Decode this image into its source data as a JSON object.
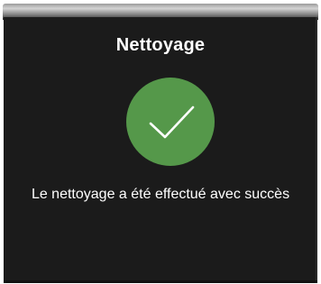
{
  "dialog": {
    "title": "Nettoyage",
    "status_icon": "checkmark-icon",
    "message": "Le nettoyage a été effectué avec succès"
  },
  "colors": {
    "screen_background": "#1b1b1b",
    "success_green": "#55984a",
    "text": "#ffffff"
  }
}
